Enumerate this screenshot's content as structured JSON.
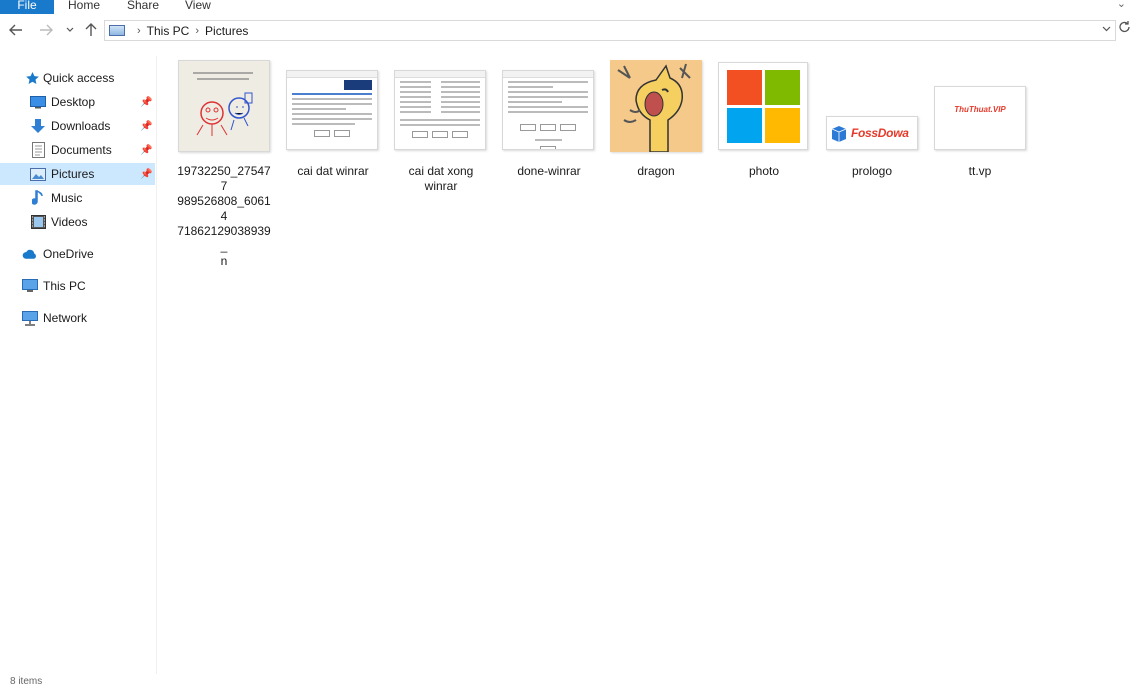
{
  "ribbon": {
    "tabs": [
      "File",
      "Home",
      "Share",
      "View"
    ],
    "collapse_icon": "chevron-down-icon"
  },
  "nav": {
    "back_icon": "arrow-left-icon",
    "forward_icon": "arrow-right-icon",
    "recent_icon": "chevron-down-icon",
    "up_icon": "arrow-up-icon"
  },
  "address": {
    "crumbs": [
      "This PC",
      "Pictures"
    ],
    "dropdown_icon": "chevron-down-icon",
    "refresh_icon": "refresh-icon"
  },
  "sidebar": {
    "quick_access": "Quick access",
    "items": [
      {
        "label": "Desktop",
        "icon": "desktop-icon",
        "pinned": true
      },
      {
        "label": "Downloads",
        "icon": "download-icon",
        "pinned": true
      },
      {
        "label": "Documents",
        "icon": "documents-icon",
        "pinned": true
      },
      {
        "label": "Pictures",
        "icon": "pictures-icon",
        "pinned": true,
        "selected": true
      },
      {
        "label": "Music",
        "icon": "music-icon",
        "pinned": false
      },
      {
        "label": "Videos",
        "icon": "videos-icon",
        "pinned": false
      }
    ],
    "onedrive": "OneDrive",
    "thispc": "This PC",
    "network": "Network"
  },
  "files": [
    {
      "name": "19732250_275477989526808_6061471862129038939_n",
      "lines": [
        "19732250_275477",
        "989526808_60614",
        "71862129038939_",
        "n"
      ]
    },
    {
      "name": "cai dat winrar",
      "lines": [
        "cai dat winrar"
      ]
    },
    {
      "name": "cai dat xong winrar",
      "lines": [
        "cai dat xong",
        "winrar"
      ]
    },
    {
      "name": "done-winrar",
      "lines": [
        "done-winrar"
      ]
    },
    {
      "name": "dragon",
      "lines": [
        "dragon"
      ]
    },
    {
      "name": "photo",
      "lines": [
        "photo"
      ]
    },
    {
      "name": "prologo",
      "lines": [
        "prologo"
      ],
      "logo_text": "FossDowa"
    },
    {
      "name": "tt.vp",
      "lines": [
        "tt.vp"
      ],
      "logo_text": "ThuThuat.VIP"
    }
  ],
  "colors": {
    "accent": "#1979ca",
    "selected": "#cce8ff",
    "ms_red": "#f25022",
    "ms_green": "#7fba00",
    "ms_blue": "#00a4ef",
    "ms_yellow": "#ffb900"
  },
  "status": {
    "text": "8 items"
  }
}
